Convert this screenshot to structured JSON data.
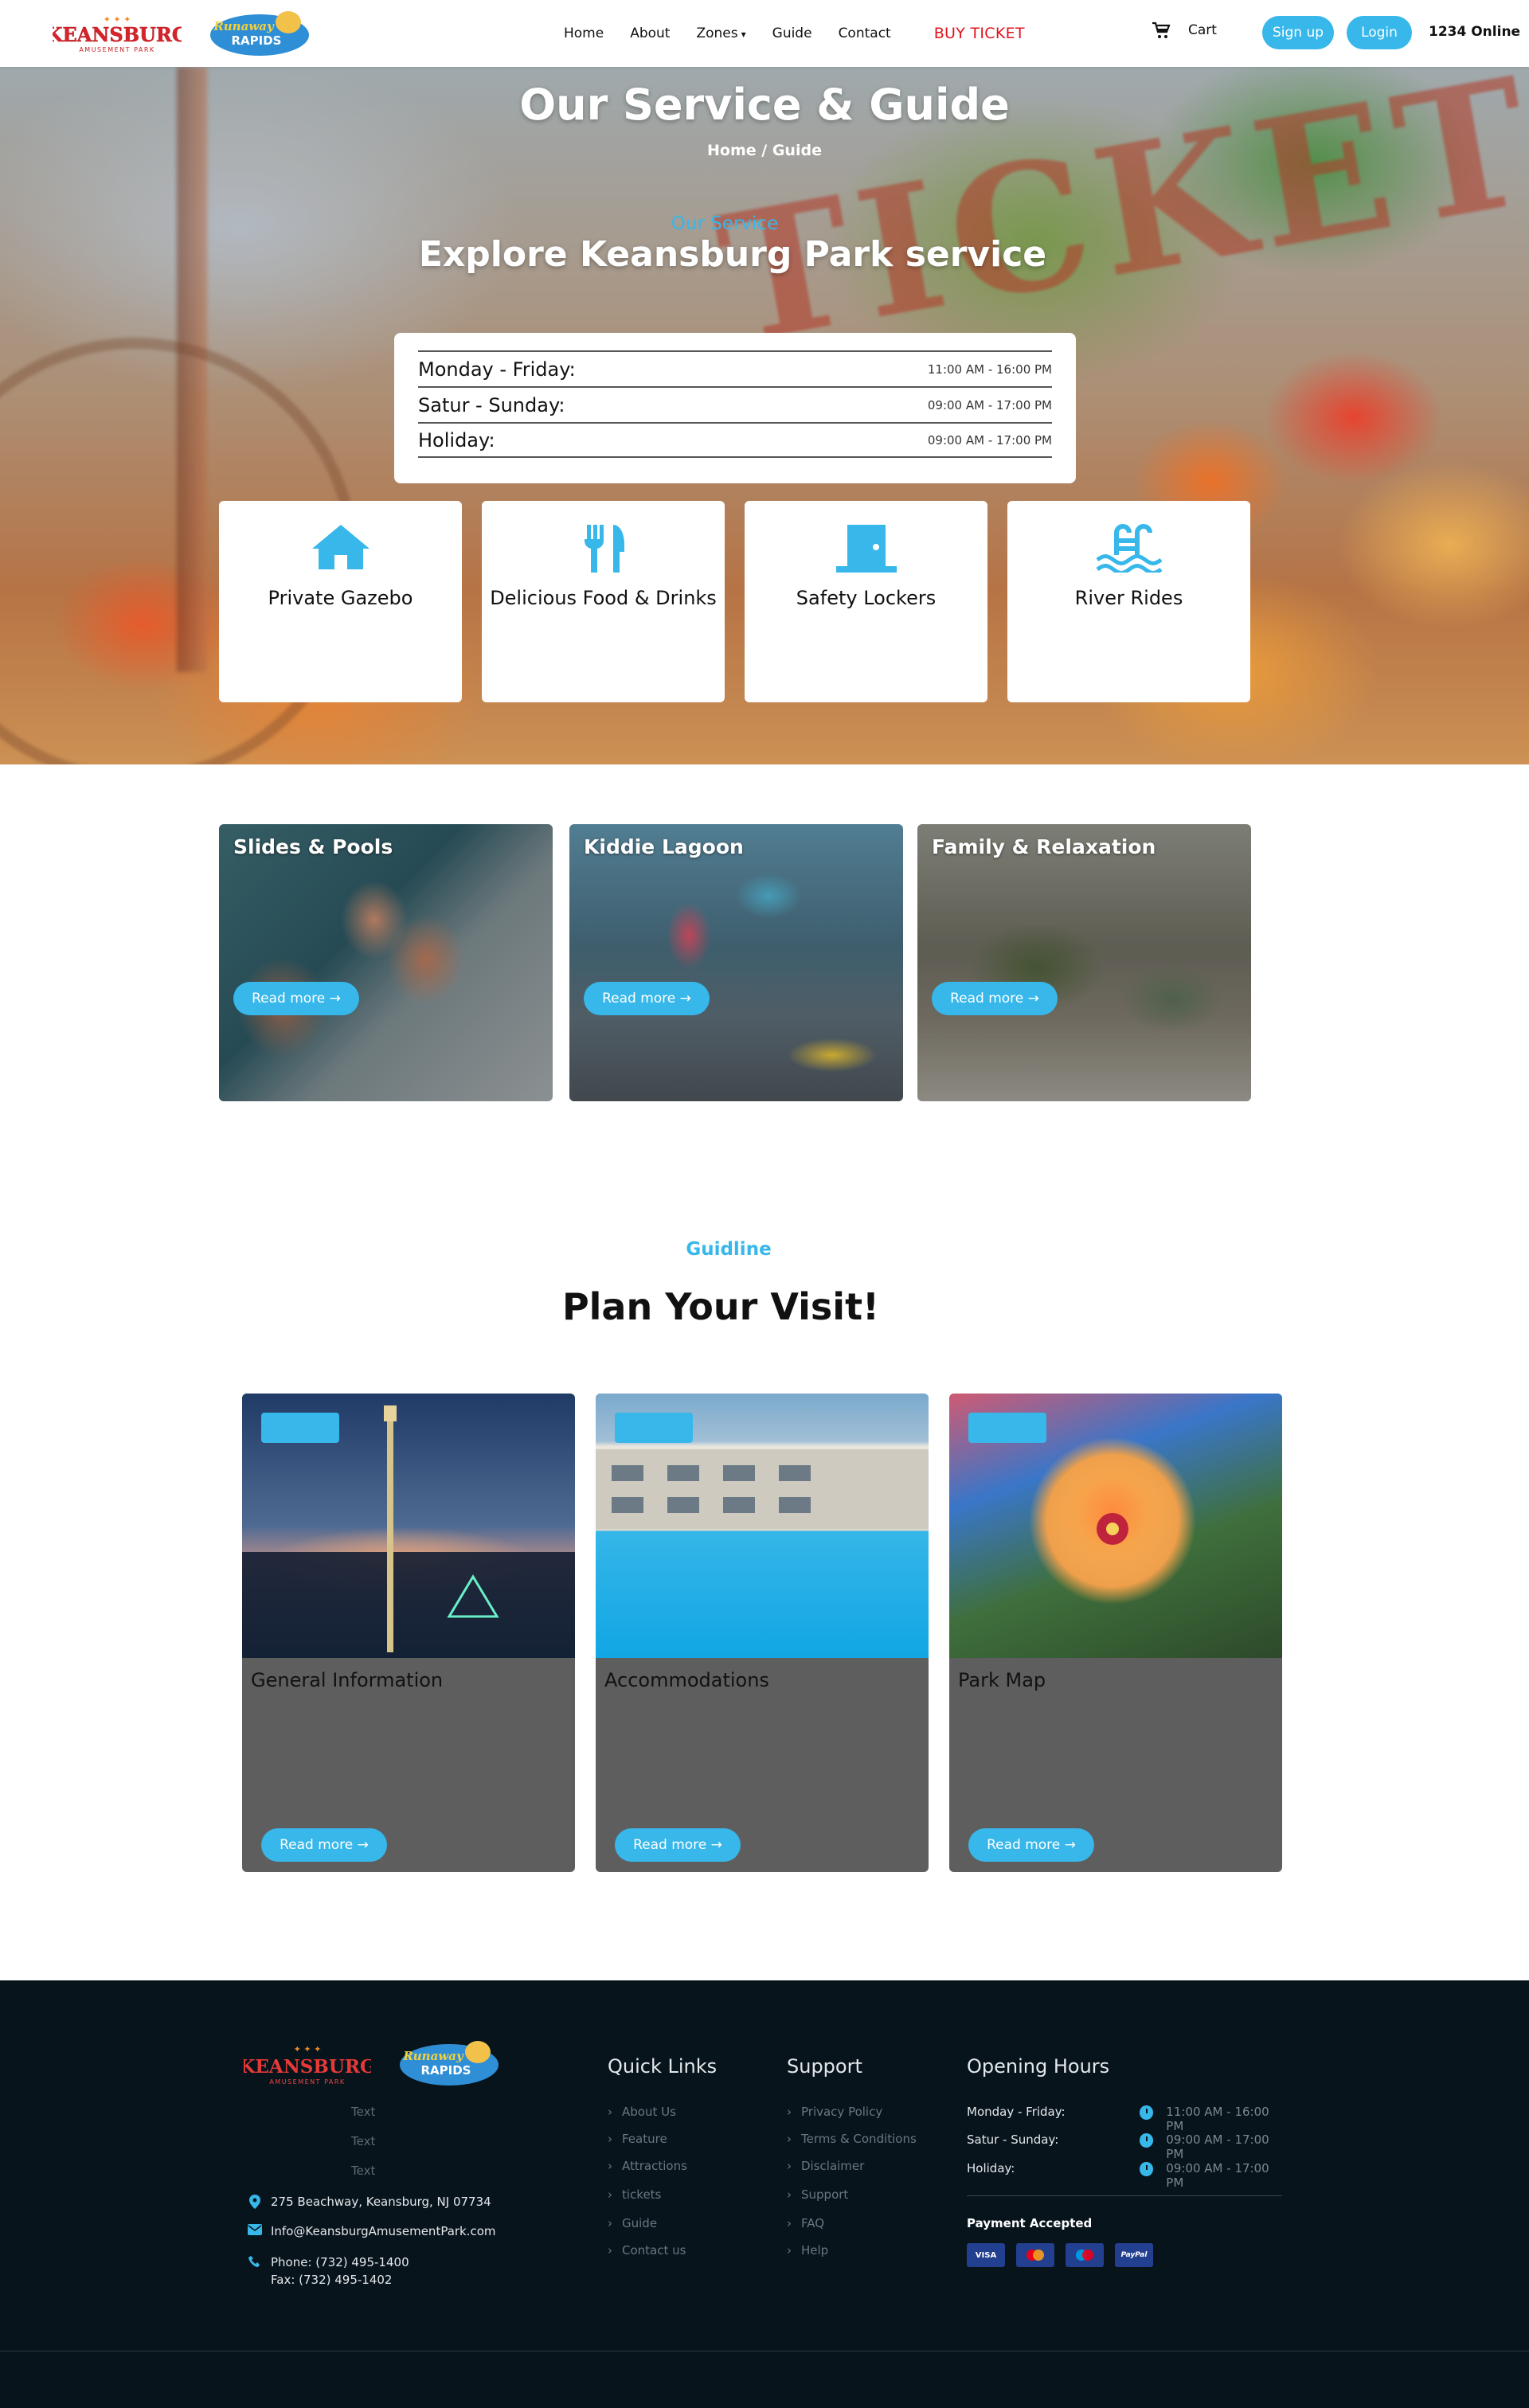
{
  "header": {
    "logo_keansburg": "KEANSBURG",
    "logo_keansburg_sub": "AMUSEMENT PARK",
    "logo_runaway": "Runaway",
    "logo_rapids": "RAPIDS",
    "nav": [
      "Home",
      "About",
      "Zones",
      "Guide",
      "Contact"
    ],
    "buy_ticket": "BUY TICKET",
    "cart": "Cart",
    "signup": "Sign up",
    "login": "Login",
    "online": "1234 Online"
  },
  "hero": {
    "title": "Our Service & Guide",
    "breadcrumb": "Home / Guide",
    "subtitle": "Our Service",
    "heading": "Explore Keansburg Park service",
    "background_word": "TICKET"
  },
  "hours": [
    {
      "day": "Monday - Friday:",
      "time": "11:00 AM - 16:00 PM"
    },
    {
      "day": "Satur - Sunday:",
      "time": "09:00 AM - 17:00 PM"
    },
    {
      "day": "Holiday:",
      "time": "09:00 AM - 17:00 PM"
    }
  ],
  "services": [
    {
      "label": "Private Gazebo",
      "icon": "home-icon"
    },
    {
      "label": "Delicious Food & Drinks",
      "icon": "utensils-icon"
    },
    {
      "label": "Safety Lockers",
      "icon": "door-icon"
    },
    {
      "label": "River Rides",
      "icon": "pool-icon"
    }
  ],
  "zones": [
    {
      "title": "Slides & Pools",
      "read_more": "Read more"
    },
    {
      "title": "Kiddie Lagoon",
      "read_more": "Read more"
    },
    {
      "title": "Family & Relaxation",
      "read_more": "Read more"
    }
  ],
  "guide": {
    "subtitle": "Guidline",
    "title": "Plan Your Visit!",
    "cards": [
      {
        "title": "General Information",
        "read_more": "Read more"
      },
      {
        "title": "Accommodations",
        "read_more": "Read more"
      },
      {
        "title": "Park Map",
        "read_more": "Read more"
      }
    ]
  },
  "footer": {
    "placeholder_texts": [
      "Text",
      "Text",
      "Text"
    ],
    "address": "275 Beachway, Keansburg, NJ 07734",
    "email": "Info@KeansburgAmusementPark.com",
    "phone": "Phone: (732) 495-1400",
    "fax": "Fax: (732) 495-1402",
    "quick_links_title": "Quick Links",
    "quick_links": [
      "About Us",
      "Feature",
      "Attractions",
      "tickets",
      "Guide",
      "Contact us"
    ],
    "support_title": "Support",
    "support_links": [
      "Privacy Policy",
      "Terms & Conditions",
      "Disclaimer",
      "Support",
      "FAQ",
      "Help"
    ],
    "opening_title": "Opening Hours",
    "opening": [
      {
        "day": "Monday - Friday:",
        "time": "11:00 AM - 16:00 PM"
      },
      {
        "day": "Satur - Sunday:",
        "time": "09:00 AM - 17:00 PM"
      },
      {
        "day": "Holiday:",
        "time": "09:00 AM - 17:00 PM"
      }
    ],
    "payment_title": "Payment Accepted",
    "payments": [
      "VISA",
      "MC",
      "Maestro",
      "PayPal"
    ]
  },
  "colors": {
    "accent": "#37b7ea",
    "buy": "#e0141e",
    "footer_bg": "#08141c",
    "card_gray": "#5e5e5e"
  }
}
